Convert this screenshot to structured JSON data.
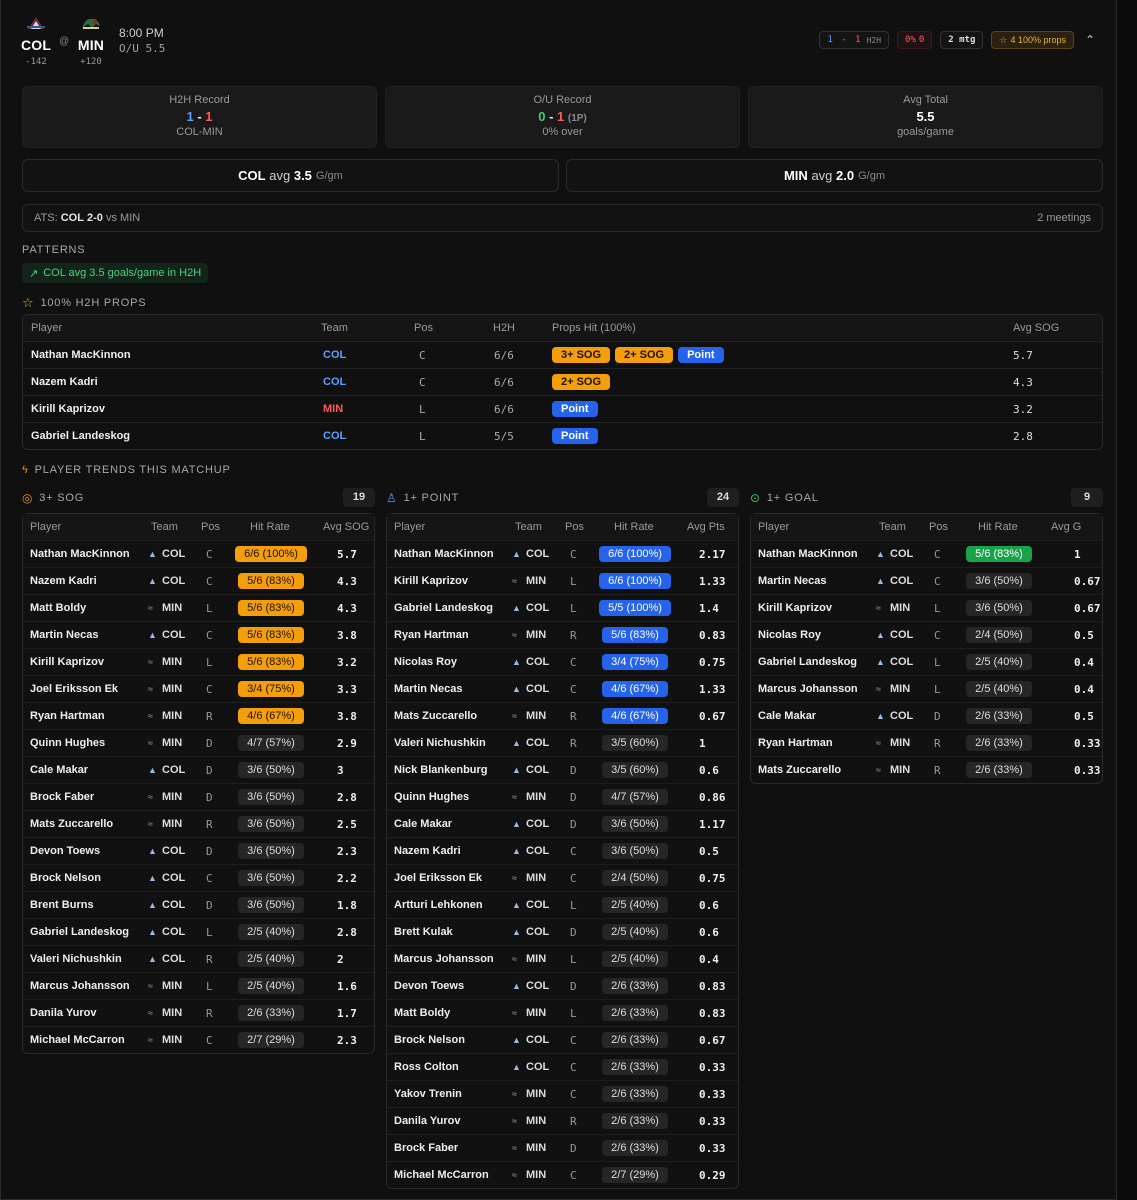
{
  "header": {
    "away": {
      "abbr": "COL",
      "odds": "-142"
    },
    "home": {
      "abbr": "MIN",
      "odds": "+120"
    },
    "at": "@",
    "time": "8:00 PM",
    "ou": "O/U 5.5",
    "badges": {
      "h2h_a": "1",
      "h2h_sep": " - ",
      "h2h_b": "1",
      "h2h_label": "H2H",
      "pct": "0%",
      "pct_val": "0",
      "mtg": "2 mtg",
      "props": "4 100% props"
    }
  },
  "stats": [
    {
      "title": "H2H Record",
      "a": "1",
      "sep": " - ",
      "b": "1",
      "sub": "COL-MIN"
    },
    {
      "title": "O/U Record",
      "a": "0",
      "sep": " - ",
      "b": "1",
      "extra": "(1P)",
      "sub": "0% over"
    },
    {
      "title": "Avg Total",
      "value": "5.5",
      "sub": "goals/game"
    }
  ],
  "avgs": [
    {
      "team": "COL",
      "label": "avg",
      "value": "3.5",
      "unit": "G/gm"
    },
    {
      "team": "MIN",
      "label": "avg",
      "value": "2.0",
      "unit": "G/gm"
    }
  ],
  "ats": {
    "prefix": "ATS:",
    "team": "COL",
    "record": "2-0",
    "suffix": "vs MIN",
    "meetings": "2 meetings"
  },
  "patterns": {
    "title": "PATTERNS",
    "item": "COL avg 3.5 goals/game in H2H"
  },
  "props": {
    "title": "100% H2H PROPS",
    "headers": [
      "Player",
      "Team",
      "Pos",
      "H2H",
      "Props Hit (100%)",
      "Avg SOG"
    ],
    "rows": [
      {
        "player": "Nathan MacKinnon",
        "team": "COL",
        "pos": "C",
        "h2h": "6/6",
        "pills": [
          "3+ SOG",
          "2+ SOG",
          "Point"
        ],
        "avg": "5.7"
      },
      {
        "player": "Nazem Kadri",
        "team": "COL",
        "pos": "C",
        "h2h": "6/6",
        "pills": [
          "2+ SOG"
        ],
        "avg": "4.3"
      },
      {
        "player": "Kirill Kaprizov",
        "team": "MIN",
        "pos": "L",
        "h2h": "6/6",
        "pills": [
          "Point"
        ],
        "avg": "3.2"
      },
      {
        "player": "Gabriel Landeskog",
        "team": "COL",
        "pos": "L",
        "h2h": "5/5",
        "pills": [
          "Point"
        ],
        "avg": "2.8"
      }
    ]
  },
  "trends": {
    "title": "PLAYER TRENDS THIS MATCHUP",
    "tables": [
      {
        "title": "3+ SOG",
        "count": "19",
        "headers": [
          "Player",
          "Team",
          "Pos",
          "Hit Rate",
          "Avg SOG"
        ],
        "rows": [
          [
            "Nathan MacKinnon",
            "COL",
            "C",
            "6/6 (100%)",
            "5.7"
          ],
          [
            "Nazem Kadri",
            "COL",
            "C",
            "5/6 (83%)",
            "4.3"
          ],
          [
            "Matt Boldy",
            "MIN",
            "L",
            "5/6 (83%)",
            "4.3"
          ],
          [
            "Martin Necas",
            "COL",
            "C",
            "5/6 (83%)",
            "3.8"
          ],
          [
            "Kirill Kaprizov",
            "MIN",
            "L",
            "5/6 (83%)",
            "3.2"
          ],
          [
            "Joel Eriksson Ek",
            "MIN",
            "C",
            "3/4 (75%)",
            "3.3"
          ],
          [
            "Ryan Hartman",
            "MIN",
            "R",
            "4/6 (67%)",
            "3.8"
          ],
          [
            "Quinn Hughes",
            "MIN",
            "D",
            "4/7 (57%)",
            "2.9"
          ],
          [
            "Cale Makar",
            "COL",
            "D",
            "3/6 (50%)",
            "3"
          ],
          [
            "Brock Faber",
            "MIN",
            "D",
            "3/6 (50%)",
            "2.8"
          ],
          [
            "Mats Zuccarello",
            "MIN",
            "R",
            "3/6 (50%)",
            "2.5"
          ],
          [
            "Devon Toews",
            "COL",
            "D",
            "3/6 (50%)",
            "2.3"
          ],
          [
            "Brock Nelson",
            "COL",
            "C",
            "3/6 (50%)",
            "2.2"
          ],
          [
            "Brent Burns",
            "COL",
            "D",
            "3/6 (50%)",
            "1.8"
          ],
          [
            "Gabriel Landeskog",
            "COL",
            "L",
            "2/5 (40%)",
            "2.8"
          ],
          [
            "Valeri Nichushkin",
            "COL",
            "R",
            "2/5 (40%)",
            "2"
          ],
          [
            "Marcus Johansson",
            "MIN",
            "L",
            "2/5 (40%)",
            "1.6"
          ],
          [
            "Danila Yurov",
            "MIN",
            "R",
            "2/6 (33%)",
            "1.7"
          ],
          [
            "Michael McCarron",
            "MIN",
            "C",
            "2/7 (29%)",
            "2.3"
          ]
        ]
      },
      {
        "title": "1+ POINT",
        "count": "24",
        "headers": [
          "Player",
          "Team",
          "Pos",
          "Hit Rate",
          "Avg Pts"
        ],
        "rows": [
          [
            "Nathan MacKinnon",
            "COL",
            "C",
            "6/6 (100%)",
            "2.17"
          ],
          [
            "Kirill Kaprizov",
            "MIN",
            "L",
            "6/6 (100%)",
            "1.33"
          ],
          [
            "Gabriel Landeskog",
            "COL",
            "L",
            "5/5 (100%)",
            "1.4"
          ],
          [
            "Ryan Hartman",
            "MIN",
            "R",
            "5/6 (83%)",
            "0.83"
          ],
          [
            "Nicolas Roy",
            "COL",
            "C",
            "3/4 (75%)",
            "0.75"
          ],
          [
            "Martin Necas",
            "COL",
            "C",
            "4/6 (67%)",
            "1.33"
          ],
          [
            "Mats Zuccarello",
            "MIN",
            "R",
            "4/6 (67%)",
            "0.67"
          ],
          [
            "Valeri Nichushkin",
            "COL",
            "R",
            "3/5 (60%)",
            "1"
          ],
          [
            "Nick Blankenburg",
            "COL",
            "D",
            "3/5 (60%)",
            "0.6"
          ],
          [
            "Quinn Hughes",
            "MIN",
            "D",
            "4/7 (57%)",
            "0.86"
          ],
          [
            "Cale Makar",
            "COL",
            "D",
            "3/6 (50%)",
            "1.17"
          ],
          [
            "Nazem Kadri",
            "COL",
            "C",
            "3/6 (50%)",
            "0.5"
          ],
          [
            "Joel Eriksson Ek",
            "MIN",
            "C",
            "2/4 (50%)",
            "0.75"
          ],
          [
            "Artturi Lehkonen",
            "COL",
            "L",
            "2/5 (40%)",
            "0.6"
          ],
          [
            "Brett Kulak",
            "COL",
            "D",
            "2/5 (40%)",
            "0.6"
          ],
          [
            "Marcus Johansson",
            "MIN",
            "L",
            "2/5 (40%)",
            "0.4"
          ],
          [
            "Devon Toews",
            "COL",
            "D",
            "2/6 (33%)",
            "0.83"
          ],
          [
            "Matt Boldy",
            "MIN",
            "L",
            "2/6 (33%)",
            "0.83"
          ],
          [
            "Brock Nelson",
            "COL",
            "C",
            "2/6 (33%)",
            "0.67"
          ],
          [
            "Ross Colton",
            "COL",
            "C",
            "2/6 (33%)",
            "0.33"
          ],
          [
            "Yakov Trenin",
            "MIN",
            "C",
            "2/6 (33%)",
            "0.33"
          ],
          [
            "Danila Yurov",
            "MIN",
            "R",
            "2/6 (33%)",
            "0.33"
          ],
          [
            "Brock Faber",
            "MIN",
            "D",
            "2/6 (33%)",
            "0.33"
          ],
          [
            "Michael McCarron",
            "MIN",
            "C",
            "2/7 (29%)",
            "0.29"
          ]
        ]
      },
      {
        "title": "1+ GOAL",
        "count": "9",
        "headers": [
          "Player",
          "Team",
          "Pos",
          "Hit Rate",
          "Avg G"
        ],
        "rows": [
          [
            "Nathan MacKinnon",
            "COL",
            "C",
            "5/6 (83%)",
            "1"
          ],
          [
            "Martin Necas",
            "COL",
            "C",
            "3/6 (50%)",
            "0.67"
          ],
          [
            "Kirill Kaprizov",
            "MIN",
            "L",
            "3/6 (50%)",
            "0.67"
          ],
          [
            "Nicolas Roy",
            "COL",
            "C",
            "2/4 (50%)",
            "0.5"
          ],
          [
            "Gabriel Landeskog",
            "COL",
            "L",
            "2/5 (40%)",
            "0.4"
          ],
          [
            "Marcus Johansson",
            "MIN",
            "L",
            "2/5 (40%)",
            "0.4"
          ],
          [
            "Cale Makar",
            "COL",
            "D",
            "2/6 (33%)",
            "0.5"
          ],
          [
            "Ryan Hartman",
            "MIN",
            "R",
            "2/6 (33%)",
            "0.33"
          ],
          [
            "Mats Zuccarello",
            "MIN",
            "R",
            "2/6 (33%)",
            "0.33"
          ]
        ]
      }
    ]
  },
  "colors": {
    "orange": "#f59e0b",
    "blue": "#2563eb",
    "green": "#16a34a",
    "gray": "#262626",
    "col": "#5aa0ff",
    "min": "#ff5a5a"
  }
}
